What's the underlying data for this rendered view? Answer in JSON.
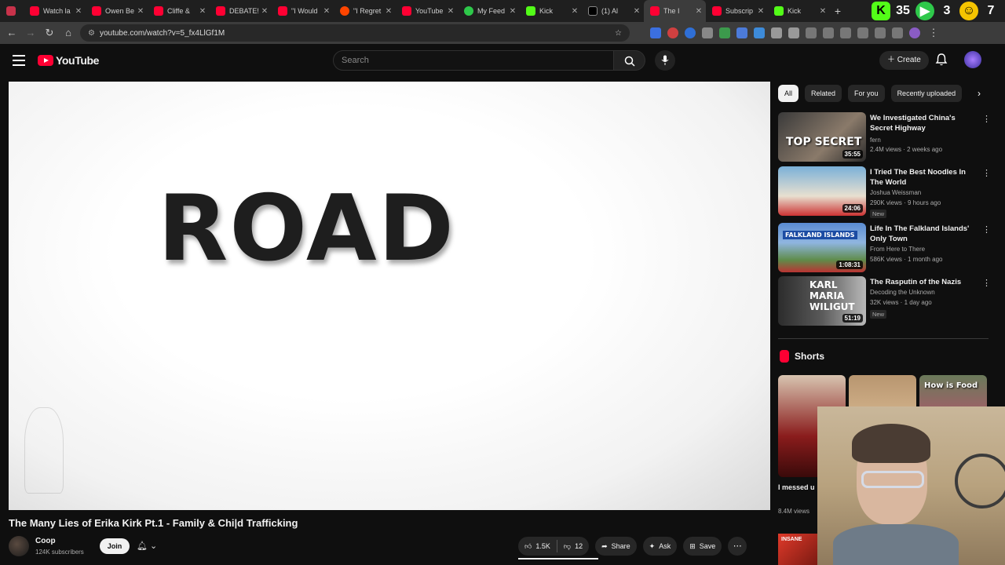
{
  "browser": {
    "tabs": [
      {
        "title": "Watch la",
        "fav": "youtube"
      },
      {
        "title": "Owen Be",
        "fav": "youtube"
      },
      {
        "title": "Cliffe &",
        "fav": "youtube"
      },
      {
        "title": "DEBATE!",
        "fav": "youtube"
      },
      {
        "title": "\"I Would",
        "fav": "youtube"
      },
      {
        "title": "\"I Regret",
        "fav": "reddit"
      },
      {
        "title": "YouTube",
        "fav": "youtube"
      },
      {
        "title": "My Feed",
        "fav": "feed"
      },
      {
        "title": "Kick",
        "fav": "kick"
      },
      {
        "title": "(1) Al",
        "fav": "x"
      },
      {
        "title": "The I",
        "fav": "youtube"
      },
      {
        "title": "Subscrip",
        "fav": "youtube"
      },
      {
        "title": "Kick",
        "fav": "kick"
      }
    ],
    "address": "youtube.com/watch?v=5_fx4LlGf1M",
    "overlay_counter_a": "35",
    "overlay_counter_b": "3",
    "overlay_counter_c": "7"
  },
  "youtube": {
    "logo_text": "YouTube",
    "search_placeholder": "Search",
    "create_label": "Create"
  },
  "video": {
    "frame_text": "ROAD",
    "title": "The Many Lies of Erika Kirk Pt.1 - Family & Chi|d Trafficking",
    "channel": "Coop",
    "subscribers": "124K subscribers",
    "join_label": "Join",
    "likes": "1.5K",
    "dislikes": "12",
    "share_label": "Share",
    "ask_label": "Ask",
    "save_label": "Save"
  },
  "sidebar": {
    "chips": [
      "All",
      "Related",
      "For you",
      "Recently uploaded"
    ],
    "recommendations": [
      {
        "title": "We Investigated China's Secret Highway",
        "channel": "fern",
        "meta": "2.4M views · 2 weeks ago",
        "duration": "35:55",
        "thumb_text": "TOP SECRET",
        "badge": ""
      },
      {
        "title": "I Tried The Best Noodles In The World",
        "channel": "Joshua Weissman",
        "meta": "290K views · 9 hours ago",
        "duration": "24:06",
        "thumb_text": "",
        "badge": "New"
      },
      {
        "title": "Life In The Falkland Islands' Only Town",
        "channel": "From Here to There",
        "meta": "586K views · 1 month ago",
        "duration": "1:08:31",
        "thumb_text": "FALKLAND ISLANDS",
        "badge": ""
      },
      {
        "title": "The Rasputin of the Nazis",
        "channel": "Decoding the Unknown",
        "meta": "32K views · 1 day ago",
        "duration": "51:19",
        "thumb_text": "KARL MARIA WILIGUT",
        "badge": "New"
      }
    ],
    "shorts_label": "Shorts",
    "shorts": [
      {
        "caption": "I messed u",
        "views": "8.4M views",
        "overlay": ""
      },
      {
        "caption": "",
        "views": "",
        "overlay": ""
      },
      {
        "caption": "",
        "views": "",
        "overlay": "How is Food"
      }
    ],
    "bottom_thumb_text": "INSANE"
  },
  "colors": {
    "background": "#0f0f0f",
    "accent": "#ff0033",
    "text": "#f1f1f1"
  }
}
